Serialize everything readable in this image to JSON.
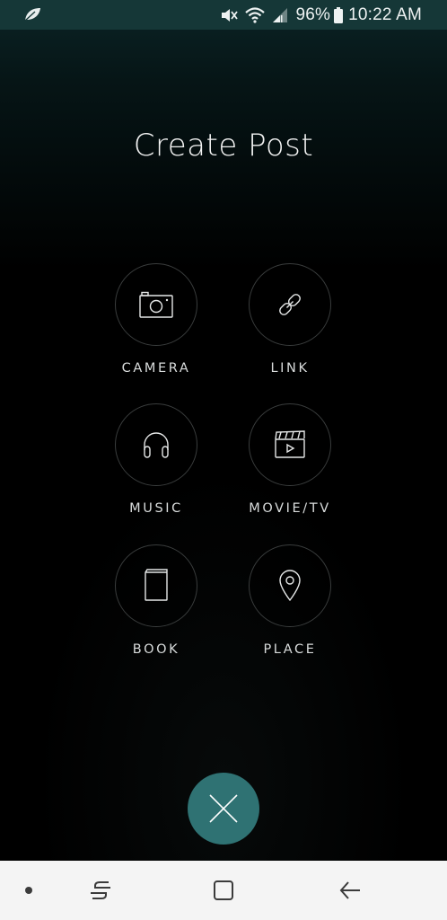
{
  "status_bar": {
    "app_icon": "leaf-icon",
    "icons": [
      "mute-icon",
      "wifi-icon",
      "signal-icon",
      "battery-icon"
    ],
    "battery_percent": "96%",
    "time": "10:22 AM"
  },
  "page": {
    "title": "Create Post"
  },
  "options": [
    {
      "label": "CAMERA",
      "icon": "camera-icon"
    },
    {
      "label": "LINK",
      "icon": "link-icon"
    },
    {
      "label": "MUSIC",
      "icon": "headphones-icon"
    },
    {
      "label": "MOVIE/TV",
      "icon": "clapperboard-icon"
    },
    {
      "label": "BOOK",
      "icon": "book-icon"
    },
    {
      "label": "PLACE",
      "icon": "map-pin-icon"
    }
  ],
  "close_button": {
    "icon": "close-icon",
    "color": "#2f7273"
  },
  "nav_bar": {
    "items": [
      "dot-icon",
      "recents-icon",
      "home-icon",
      "back-icon"
    ]
  },
  "colors": {
    "status_bar": "#153737",
    "accent": "#2f7273",
    "background": "#000000",
    "nav_bar": "#f4f4f4"
  }
}
